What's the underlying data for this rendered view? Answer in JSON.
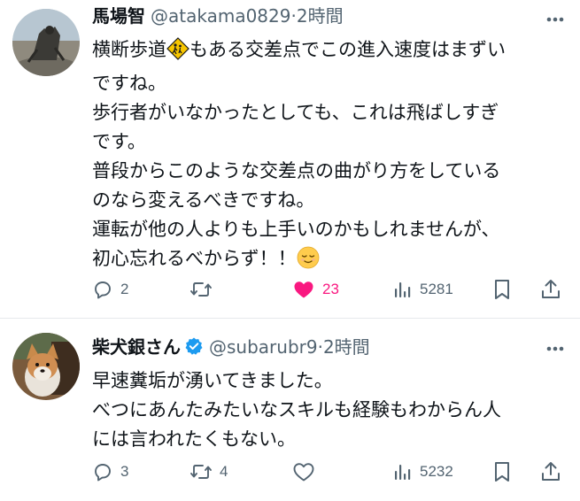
{
  "tweets": [
    {
      "author": {
        "display_name": "馬場智",
        "handle": "@atakama0829",
        "verified": false
      },
      "separator": "·",
      "time": "2時間",
      "text_lines": [
        {
          "before": "横断歩道",
          "emoji": "school-crossing-sign-icon",
          "after": "もある交差点でこの進入速度はまずい"
        },
        {
          "text": "ですね。"
        },
        {
          "text": "歩行者がいなかったとしても、これは飛ばしすぎ"
        },
        {
          "text": "です。"
        },
        {
          "text": "普段からこのような交差点の曲がり方をしている"
        },
        {
          "text": "のなら変えるべきですね。"
        },
        {
          "text": "運転が他の人よりも上手いのかもしれませんが、"
        },
        {
          "before": "初心忘れるべからず！！",
          "emoji": "relieved-face-icon",
          "after": ""
        }
      ],
      "actions": {
        "replies": "2",
        "reposts": "",
        "likes": "23",
        "liked": true,
        "views": "5281"
      }
    },
    {
      "author": {
        "display_name": "柴犬銀さん",
        "handle": "@subarubr9",
        "verified": true
      },
      "separator": "·",
      "time": "2時間",
      "text_lines": [
        {
          "text": "早速糞垢が湧いてきました。"
        },
        {
          "text": "べつにあんたみたいなスキルも経験もわからん人"
        },
        {
          "text": "には言われたくもない。"
        }
      ],
      "actions": {
        "replies": "3",
        "reposts": "4",
        "likes": "",
        "liked": false,
        "views": "5232"
      }
    }
  ],
  "colors": {
    "text_primary": "#0f1419",
    "text_secondary": "#536471",
    "like_active": "#f91880",
    "verified_blue": "#1d9bf0",
    "divider": "#e6e9ec"
  }
}
